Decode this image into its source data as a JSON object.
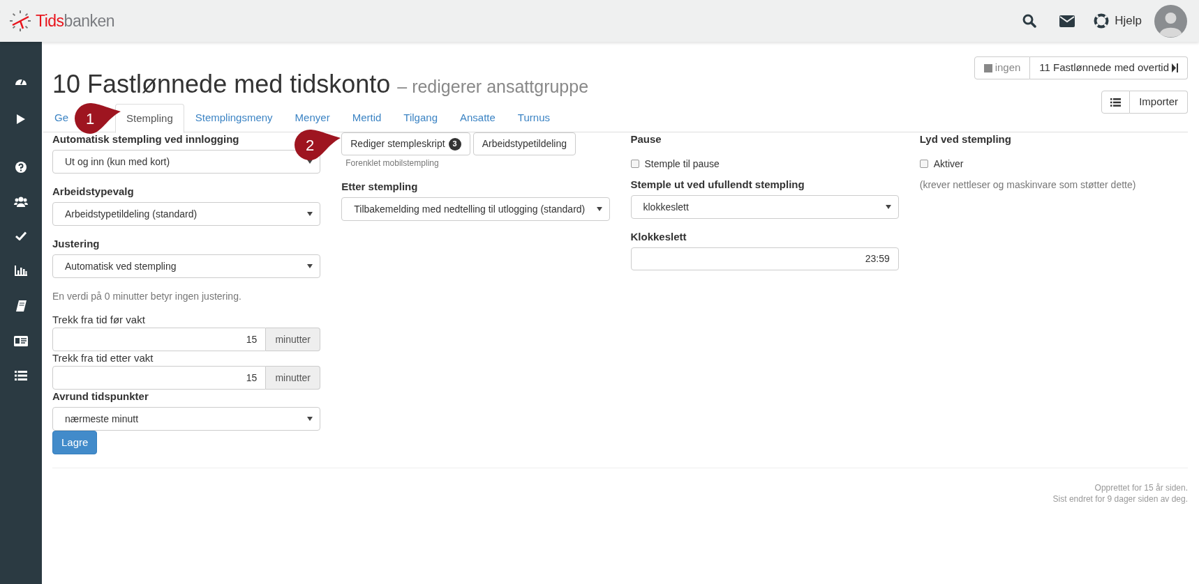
{
  "header": {
    "logo": {
      "brand_part": "Tids",
      "rest": "banken"
    },
    "help_label": "Hjelp"
  },
  "page": {
    "title": "10 Fastlønnede med tidskonto",
    "subtitle": "– redigerer ansattgruppe"
  },
  "nav_buttons": [
    {
      "label": "ingen",
      "disabled": true
    },
    {
      "label": "11 Fastlønnede med overtid",
      "disabled": false
    }
  ],
  "import_button": "Importer",
  "tabs": [
    {
      "label": "Ge",
      "selected": false
    },
    {
      "label": "Stempling",
      "selected": true
    },
    {
      "label": "Stemplingsmeny",
      "selected": false
    },
    {
      "label": "Menyer",
      "selected": false
    },
    {
      "label": "Mertid",
      "selected": false
    },
    {
      "label": "Tilgang",
      "selected": false
    },
    {
      "label": "Ansatte",
      "selected": false
    },
    {
      "label": "Turnus",
      "selected": false
    }
  ],
  "annotations": [
    {
      "number": "1"
    },
    {
      "number": "2"
    }
  ],
  "columns": [
    [
      {
        "kind": "select",
        "label": "Automatisk stempling ved innlogging",
        "value": "Ut og inn (kun med kort)"
      },
      {
        "kind": "select",
        "label": "Arbeidstypevalg",
        "value": "Arbeidstypetildeling (standard)"
      },
      {
        "kind": "select",
        "label": "Justering",
        "value": "Automatisk ved stempling"
      },
      {
        "kind": "help",
        "text": "En verdi på 0 minutter betyr ingen justering."
      },
      {
        "kind": "unit_input",
        "label": "Trekk fra tid før vakt",
        "value": "15",
        "unit": "minutter"
      },
      {
        "kind": "unit_input",
        "label": "Trekk fra tid etter vakt",
        "value": "15",
        "unit": "minutter"
      },
      {
        "kind": "select",
        "label": "Avrund tidspunkter",
        "value": "nærmeste minutt"
      },
      {
        "kind": "button",
        "label": "Lagre"
      }
    ],
    [
      {
        "kind": "button_group",
        "buttons": [
          {
            "label": "Rediger stempleskript",
            "badge": "3"
          },
          {
            "label": "Arbeidstypetildeling"
          }
        ],
        "hint": "Forenklet mobilstempling"
      },
      {
        "kind": "select",
        "label": "Etter stempling",
        "value": "Tilbakemelding med nedtelling til utlogging (standard)"
      }
    ],
    [
      {
        "kind": "checkbox",
        "label": "Pause",
        "option": "Stemple til pause",
        "checked": false
      },
      {
        "kind": "select",
        "label": "Stemple ut ved ufullendt stempling",
        "value": "klokkeslett"
      },
      {
        "kind": "text_input",
        "label": "Klokkeslett",
        "value": "23:59"
      }
    ],
    [
      {
        "kind": "checkbox",
        "label": "Lyd ved stempling",
        "option": "Aktiver",
        "checked": false
      },
      {
        "kind": "help",
        "text": "(krever nettleser og maskinvare som støtter dette)"
      }
    ]
  ],
  "footer": [
    "Opprettet for 15 år siden.",
    "Sist endret for 9 dager siden av deg."
  ]
}
